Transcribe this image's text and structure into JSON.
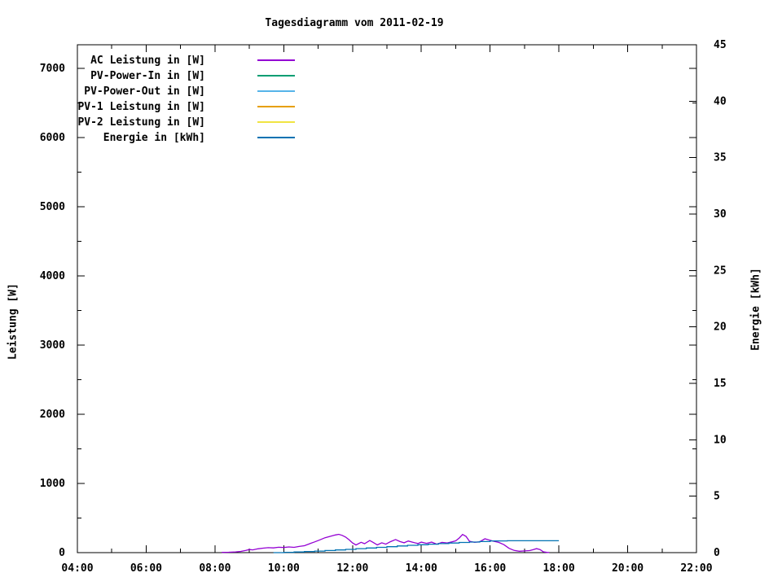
{
  "title": "Tagesdiagramm vom 2011-02-19",
  "colors": {
    "background": "#ffffff",
    "axis": "#000000",
    "text": "#000000"
  },
  "chart_data": {
    "type": "line",
    "title": "Tagesdiagramm vom 2011-02-19",
    "grid": false,
    "x_axis": {
      "start_hour": 4,
      "end_hour": 22,
      "major_step_hours": 2,
      "minor_step_hours": 1,
      "tick_labels": [
        "04:00",
        "06:00",
        "08:00",
        "10:00",
        "12:00",
        "14:00",
        "16:00",
        "18:00",
        "20:00",
        "22:00"
      ]
    },
    "y_axis_left": {
      "label": "Leistung [W]",
      "min": 0,
      "max": 7300,
      "major_step": 1000,
      "minor_step": 500,
      "tick_labels": [
        "0",
        "1000",
        "2000",
        "3000",
        "4000",
        "5000",
        "6000",
        "7000"
      ]
    },
    "y_axis_right": {
      "label": "Energie [kWh]",
      "min": 0,
      "max": 45,
      "major_step": 5,
      "tick_labels": [
        "0",
        "5",
        "10",
        "15",
        "20",
        "25",
        "30",
        "35",
        "40",
        "45"
      ]
    },
    "legend": {
      "position": "inside-top-left",
      "entries": [
        {
          "label": "AC Leistung in [W]",
          "color": "#9400d3"
        },
        {
          "label": "PV-Power-In in [W]",
          "color": "#009e73"
        },
        {
          "label": "PV-Power-Out in [W]",
          "color": "#56b4e9"
        },
        {
          "label": "PV-1 Leistung in [W]",
          "color": "#e69f00"
        },
        {
          "label": "PV-2 Leistung in [W]",
          "color": "#f0e442"
        },
        {
          "label": "Energie in [kWh]",
          "color": "#0072b2"
        }
      ]
    },
    "series": [
      {
        "name": "AC Leistung in [W]",
        "color": "#9400d3",
        "axis": "left",
        "style": "line",
        "unit": "W",
        "points": [
          [
            8.2,
            3
          ],
          [
            8.4,
            6
          ],
          [
            8.6,
            10
          ],
          [
            8.75,
            18
          ],
          [
            8.9,
            32
          ],
          [
            9.0,
            45
          ],
          [
            9.1,
            40
          ],
          [
            9.25,
            55
          ],
          [
            9.4,
            65
          ],
          [
            9.55,
            72
          ],
          [
            9.7,
            68
          ],
          [
            9.85,
            78
          ],
          [
            10.0,
            74
          ],
          [
            10.15,
            82
          ],
          [
            10.3,
            76
          ],
          [
            10.45,
            90
          ],
          [
            10.6,
            100
          ],
          [
            10.75,
            128
          ],
          [
            10.9,
            155
          ],
          [
            11.05,
            185
          ],
          [
            11.2,
            215
          ],
          [
            11.35,
            235
          ],
          [
            11.5,
            255
          ],
          [
            11.6,
            265
          ],
          [
            11.7,
            250
          ],
          [
            11.8,
            225
          ],
          [
            11.9,
            185
          ],
          [
            12.0,
            140
          ],
          [
            12.1,
            110
          ],
          [
            12.25,
            150
          ],
          [
            12.35,
            130
          ],
          [
            12.5,
            175
          ],
          [
            12.6,
            148
          ],
          [
            12.72,
            112
          ],
          [
            12.85,
            142
          ],
          [
            12.97,
            122
          ],
          [
            13.1,
            158
          ],
          [
            13.25,
            190
          ],
          [
            13.38,
            160
          ],
          [
            13.5,
            142
          ],
          [
            13.62,
            168
          ],
          [
            13.75,
            150
          ],
          [
            13.9,
            132
          ],
          [
            14.0,
            152
          ],
          [
            14.15,
            134
          ],
          [
            14.3,
            152
          ],
          [
            14.45,
            122
          ],
          [
            14.6,
            148
          ],
          [
            14.75,
            140
          ],
          [
            14.9,
            158
          ],
          [
            15.0,
            170
          ],
          [
            15.1,
            210
          ],
          [
            15.2,
            262
          ],
          [
            15.3,
            235
          ],
          [
            15.4,
            165
          ],
          [
            15.55,
            148
          ],
          [
            15.7,
            158
          ],
          [
            15.85,
            200
          ],
          [
            15.95,
            185
          ],
          [
            16.1,
            165
          ],
          [
            16.25,
            148
          ],
          [
            16.4,
            115
          ],
          [
            16.55,
            62
          ],
          [
            16.7,
            32
          ],
          [
            16.85,
            20
          ],
          [
            17.0,
            25
          ],
          [
            17.15,
            30
          ],
          [
            17.25,
            42
          ],
          [
            17.35,
            58
          ],
          [
            17.45,
            45
          ],
          [
            17.55,
            12
          ],
          [
            17.65,
            3
          ],
          [
            17.72,
            2
          ]
        ]
      },
      {
        "name": "PV-Power-In in [W]",
        "color": "#009e73",
        "axis": "left",
        "style": "line",
        "unit": "W",
        "visible_in_plot": false,
        "points": []
      },
      {
        "name": "PV-Power-Out in [W]",
        "color": "#56b4e9",
        "axis": "left",
        "style": "line",
        "unit": "W",
        "visible_in_plot": false,
        "points": []
      },
      {
        "name": "PV-1 Leistung in [W]",
        "color": "#e69f00",
        "axis": "left",
        "style": "line",
        "unit": "W",
        "visible_in_plot": false,
        "points": []
      },
      {
        "name": "PV-2 Leistung in [W]",
        "color": "#f0e442",
        "axis": "left",
        "style": "line",
        "unit": "W",
        "visible_in_plot": false,
        "points": []
      },
      {
        "name": "Energie in [kWh]",
        "color": "#0072b2",
        "axis": "right",
        "style": "steps",
        "unit": "kWh",
        "points": [
          [
            9.7,
            0
          ],
          [
            10.0,
            0.03
          ],
          [
            10.3,
            0.06
          ],
          [
            10.6,
            0.1
          ],
          [
            10.9,
            0.14
          ],
          [
            11.2,
            0.19
          ],
          [
            11.5,
            0.24
          ],
          [
            11.8,
            0.29
          ],
          [
            12.1,
            0.35
          ],
          [
            12.4,
            0.41
          ],
          [
            12.7,
            0.47
          ],
          [
            13.0,
            0.53
          ],
          [
            13.3,
            0.59
          ],
          [
            13.6,
            0.65
          ],
          [
            13.9,
            0.7
          ],
          [
            14.2,
            0.75
          ],
          [
            14.5,
            0.8
          ],
          [
            14.8,
            0.85
          ],
          [
            15.1,
            0.9
          ],
          [
            15.4,
            0.94
          ],
          [
            15.7,
            0.98
          ],
          [
            16.0,
            1.04
          ],
          [
            16.5,
            1.05
          ],
          [
            18.0,
            1.05
          ]
        ]
      }
    ]
  }
}
